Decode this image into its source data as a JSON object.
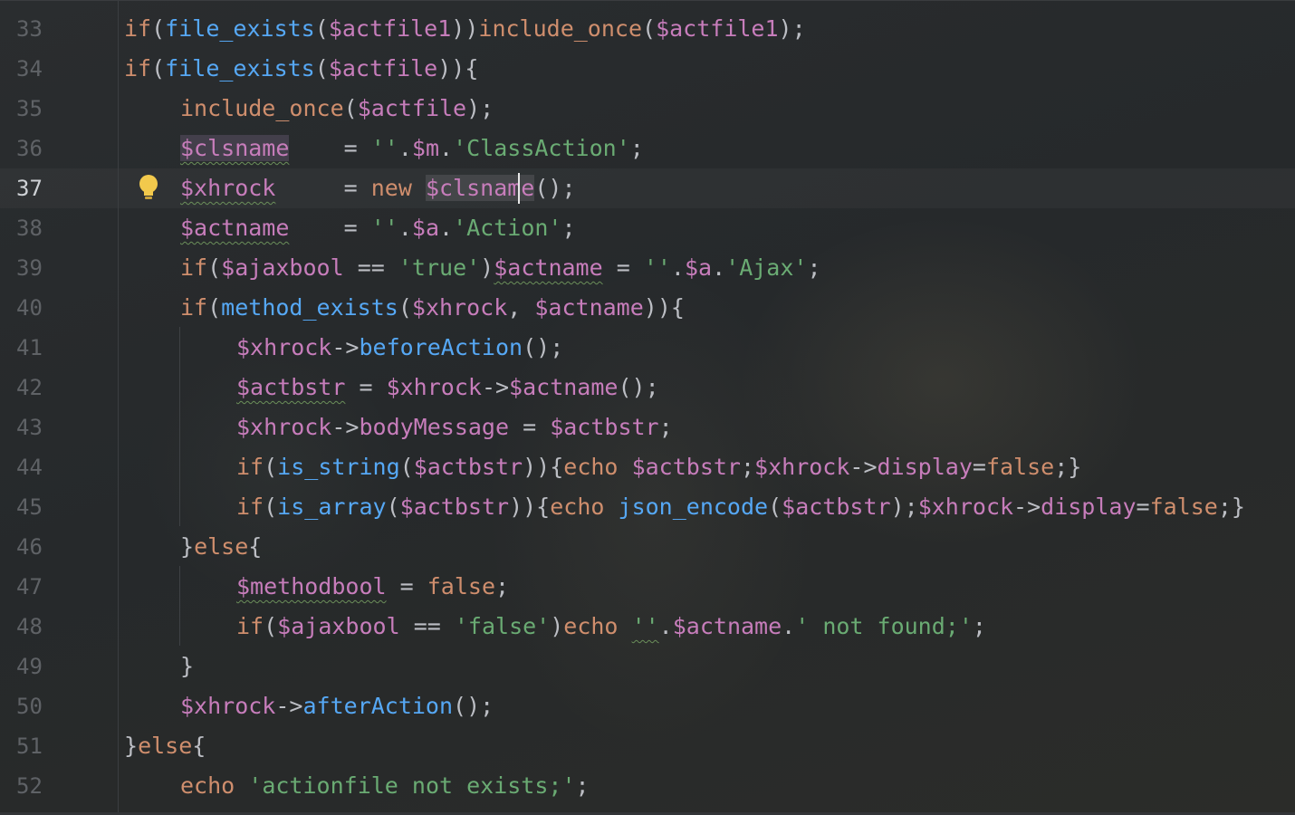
{
  "editor": {
    "gutter": {
      "line_numbers": [
        "33",
        "34",
        "35",
        "36",
        "37",
        "38",
        "39",
        "40",
        "41",
        "42",
        "43",
        "44",
        "45",
        "46",
        "47",
        "48",
        "49",
        "50",
        "51",
        "52"
      ],
      "current_line": "37"
    },
    "code": {
      "l33": [
        "if",
        "(",
        "file_exists",
        "(",
        "$actfile1",
        "))",
        "include_once",
        "(",
        "$actfile1",
        ");"
      ],
      "l34": [
        "if",
        "(",
        "file_exists",
        "(",
        "$actfile",
        ")){"
      ],
      "l35": [
        "include_once",
        "(",
        "$actfile",
        ");"
      ],
      "l36": [
        "$clsname",
        "    = ",
        "''",
        ".",
        "$m",
        ".",
        "'ClassAction'",
        ";"
      ],
      "l37": [
        "$xhrock",
        "     = ",
        "new",
        " ",
        "$clsname",
        "();"
      ],
      "l38": [
        "$actname",
        "    = ",
        "''",
        ".",
        "$a",
        ".",
        "'Action'",
        ";"
      ],
      "l39": [
        "if",
        "(",
        "$ajaxbool",
        " == ",
        "'true'",
        ")",
        "$actname",
        " = ",
        "''",
        ".",
        "$a",
        ".",
        "'Ajax'",
        ";"
      ],
      "l40": [
        "if",
        "(",
        "method_exists",
        "(",
        "$xhrock",
        ", ",
        "$actname",
        ")){"
      ],
      "l41": [
        "$xhrock",
        "->",
        "beforeAction",
        "();"
      ],
      "l42": [
        "$actbstr",
        " = ",
        "$xhrock",
        "->",
        "$actname",
        "();"
      ],
      "l43": [
        "$xhrock",
        "->",
        "bodyMessage",
        " = ",
        "$actbstr",
        ";"
      ],
      "l44": [
        "if",
        "(",
        "is_string",
        "(",
        "$actbstr",
        ")){",
        "echo",
        " ",
        "$actbstr",
        ";",
        "$xhrock",
        "->",
        "display",
        "=",
        "false",
        ";}"
      ],
      "l45": [
        "if",
        "(",
        "is_array",
        "(",
        "$actbstr",
        ")){",
        "echo",
        " ",
        "json_encode",
        "(",
        "$actbstr",
        ");",
        "$xhrock",
        "->",
        "display",
        "=",
        "false",
        ";}"
      ],
      "l46": [
        "}",
        "else",
        "{"
      ],
      "l47": [
        "$methodbool",
        " = ",
        "false",
        ";"
      ],
      "l48": [
        "if",
        "(",
        "$ajaxbool",
        " == ",
        "'false'",
        ")",
        "echo",
        " ",
        "''",
        ".",
        "$actname",
        ".",
        "' not found;'",
        ";"
      ],
      "l49": [
        "}"
      ],
      "l50": [
        "$xhrock",
        "->",
        "afterAction",
        "();"
      ],
      "l51": [
        "}",
        "else",
        "{"
      ],
      "l52": [
        "echo",
        " ",
        "'actionfile not exists;'",
        ";"
      ]
    },
    "intention_icon": "lightbulb-icon"
  },
  "colors": {
    "keyword": "#cf8e6d",
    "function": "#56a8f5",
    "variable": "#c77dbb",
    "string": "#6aab73",
    "plain": "#bcbec4",
    "line_number": "#5f6266"
  }
}
